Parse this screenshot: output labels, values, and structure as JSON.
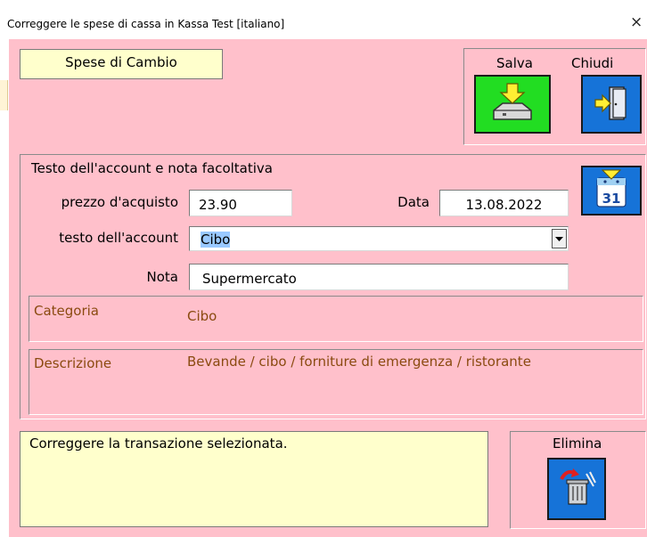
{
  "window": {
    "title": "Correggere le spese di cassa in Kassa Test  [italiano]",
    "close_glyph": "×"
  },
  "header": {
    "section_label": "Spese di Cambio"
  },
  "toolbar": {
    "save_label": "Salva",
    "close_label": "Chiudi",
    "save_icon": "tray-download-icon",
    "close_icon": "exit-door-icon"
  },
  "account": {
    "legend": "Testo dell'account e nota facoltativa",
    "price_label": "prezzo d'acquisto",
    "price_value": "23.90",
    "date_label": "Data",
    "date_value": "13.08.2022",
    "calendar_day": "31",
    "account_text_label": "testo dell'account",
    "account_text_value": "Cibo",
    "note_label": "Nota",
    "note_value": "Supermercato",
    "category_label": "Categoria",
    "category_value": "Cibo",
    "description_label": "Descrizione",
    "description_value": "Bevande / cibo / forniture di emergenza / ristorante"
  },
  "status": {
    "message": "Correggere la transazione selezionata."
  },
  "delete": {
    "label": "Elimina",
    "icon": "trash-icon"
  },
  "colors": {
    "form_background": "#ffc0cb",
    "yellow_panel": "#ffffcc",
    "save_green": "#22dd22",
    "action_blue": "#1673d8",
    "info_brown": "#8a4a10"
  }
}
